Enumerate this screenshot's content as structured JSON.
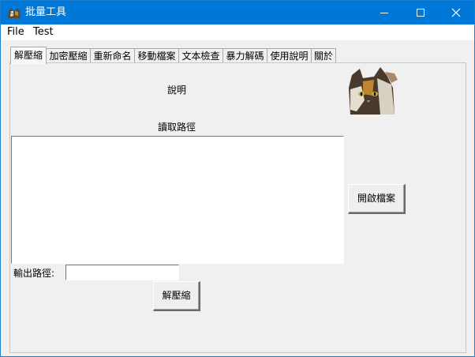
{
  "window": {
    "title": "批量工具",
    "icon": "cat-icon",
    "controls": [
      "minimize-icon",
      "maximize-icon",
      "close-icon"
    ]
  },
  "menu": [
    "File",
    "Test"
  ],
  "tabs": {
    "items": [
      "解壓縮",
      "加密壓縮",
      "重新命名",
      "移動檔案",
      "文本檢查",
      "暴力解碼",
      "使用說明",
      "關於"
    ],
    "active": "解壓縮"
  },
  "panel": {
    "description_label": "說明",
    "read_path_label": "讀取路徑",
    "read_path_value": "",
    "open_file_button": "開啟檔案",
    "output_path_label": "輸出路徑:",
    "output_path_value": "",
    "decompress_button": "解壓縮",
    "image": "cat-picture"
  },
  "colors": {
    "titlebar": "#0078d7",
    "background": "#f0f0f0"
  }
}
